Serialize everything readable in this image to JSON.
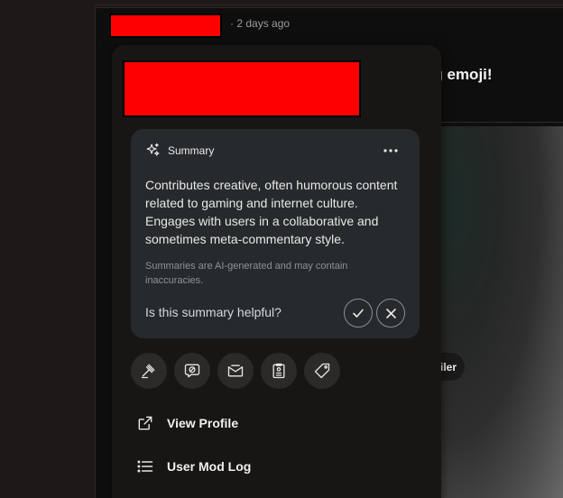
{
  "post": {
    "time": "2 days ago",
    "title_fragment": "ng emoji!",
    "spoiler_fragment": "iler"
  },
  "summary": {
    "label": "Summary",
    "text": "Contributes creative, often humorous content related to gaming and internet culture. Engages with users in a collaborative and sometimes meta-commentary style.",
    "disclaimer": "Summaries are AI-generated and may contain inaccuracies.",
    "helpful_question": "Is this summary helpful?"
  },
  "actions": [
    {
      "icon": "gavel-icon"
    },
    {
      "icon": "ban-chat-icon"
    },
    {
      "icon": "mail-open-icon"
    },
    {
      "icon": "user-notes-icon"
    },
    {
      "icon": "tag-icon"
    }
  ],
  "menu": {
    "view_profile": "View Profile",
    "mod_log": "User Mod Log"
  },
  "colors": {
    "background": "#1c1918",
    "popover": "#181615",
    "summary_card": "#262a2d",
    "action_button": "#2c2a29",
    "redaction": "#ff0000"
  }
}
